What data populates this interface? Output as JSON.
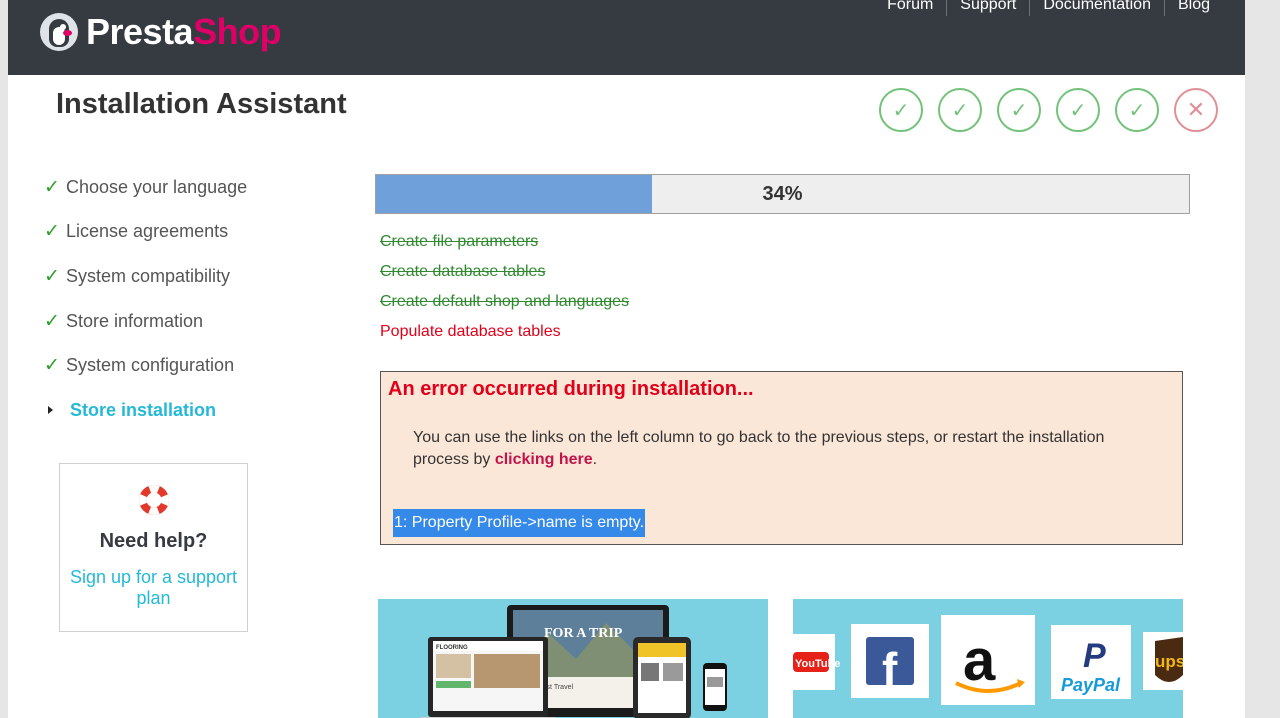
{
  "header": {
    "logo_presta": "Presta",
    "logo_shop": "Shop",
    "nav": [
      "Forum",
      "Support",
      "Documentation",
      "Blog"
    ]
  },
  "page_title": "Installation Assistant",
  "step_circles": [
    "✓",
    "✓",
    "✓",
    "✓",
    "✓",
    "✕"
  ],
  "steps": [
    {
      "label": "Choose your language",
      "status": "done"
    },
    {
      "label": "License agreements",
      "status": "done"
    },
    {
      "label": "System compatibility",
      "status": "done"
    },
    {
      "label": "Store information",
      "status": "done"
    },
    {
      "label": "System configuration",
      "status": "done"
    },
    {
      "label": "Store installation",
      "status": "current"
    }
  ],
  "help": {
    "title": "Need help?",
    "link": "Sign up for a support plan"
  },
  "progress": {
    "percent": 34,
    "label": "34%"
  },
  "tasks": [
    {
      "label": "Create file parameters",
      "status": "done"
    },
    {
      "label": "Create database tables",
      "status": "done"
    },
    {
      "label": "Create default shop and languages",
      "status": "done"
    },
    {
      "label": "Populate database tables",
      "status": "failed"
    }
  ],
  "error": {
    "title": "An error occurred during installation...",
    "desc_before": "You can use the links on the left column to go back to the previous steps, or restart the installation process by ",
    "link": "clicking here",
    "desc_after": ".",
    "message": "1: Property Profile->name is empty."
  },
  "promo_right": {
    "youtube": "YouTube",
    "facebook": "f",
    "amazon": "a",
    "paypal": "PayPal",
    "ups": "ups"
  },
  "promo_left": {
    "headline": "FOR A TRIP",
    "site_name": "FLOORING",
    "caption": "Best Travel"
  },
  "colors": {
    "header_bg": "#363a41",
    "accent_pink": "#df0067",
    "accent_blue": "#25b9d7",
    "success_green": "#72c279",
    "error_red": "#e0001a",
    "progress_fill": "#6fa0da",
    "error_bg": "#fbe7d8"
  }
}
